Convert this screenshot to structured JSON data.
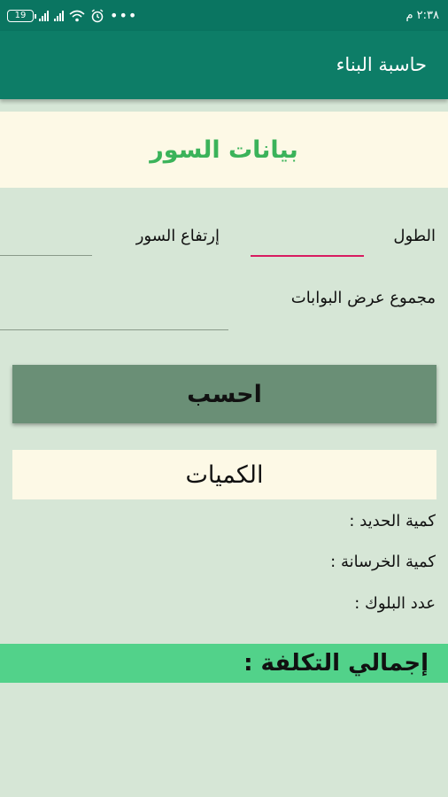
{
  "status_bar": {
    "time": "٢:٣٨ م",
    "battery": "19",
    "icons": [
      "battery-icon",
      "signal-icon",
      "signal-icon",
      "wifi-icon",
      "alarm-icon",
      "more-icon"
    ]
  },
  "app_bar": {
    "title": "حاسبة البناء"
  },
  "wall_section": {
    "title": "بيانات السور"
  },
  "form": {
    "length_label": "الطول",
    "length_value": "",
    "height_label": "إرتفاع السور",
    "height_value": "",
    "gates_label": "مجموع عرض البوابات",
    "gates_value": ""
  },
  "calculate_button": {
    "label": "احسب"
  },
  "quantities": {
    "title": "الكميات",
    "iron_label": "كمية الحديد :",
    "concrete_label": "كمية الخرسانة :",
    "blocks_label": "عدد البلوك :"
  },
  "total_cost": {
    "label": "إجمالي التكلفة :"
  },
  "colors": {
    "status_bar": "#0a7561",
    "app_bar": "#0d7d67",
    "background": "#d6e6d6",
    "section_title": "#3bb35a",
    "button": "#6a8f76",
    "total_bar": "#52d28a",
    "focus_line": "#d81b60"
  }
}
